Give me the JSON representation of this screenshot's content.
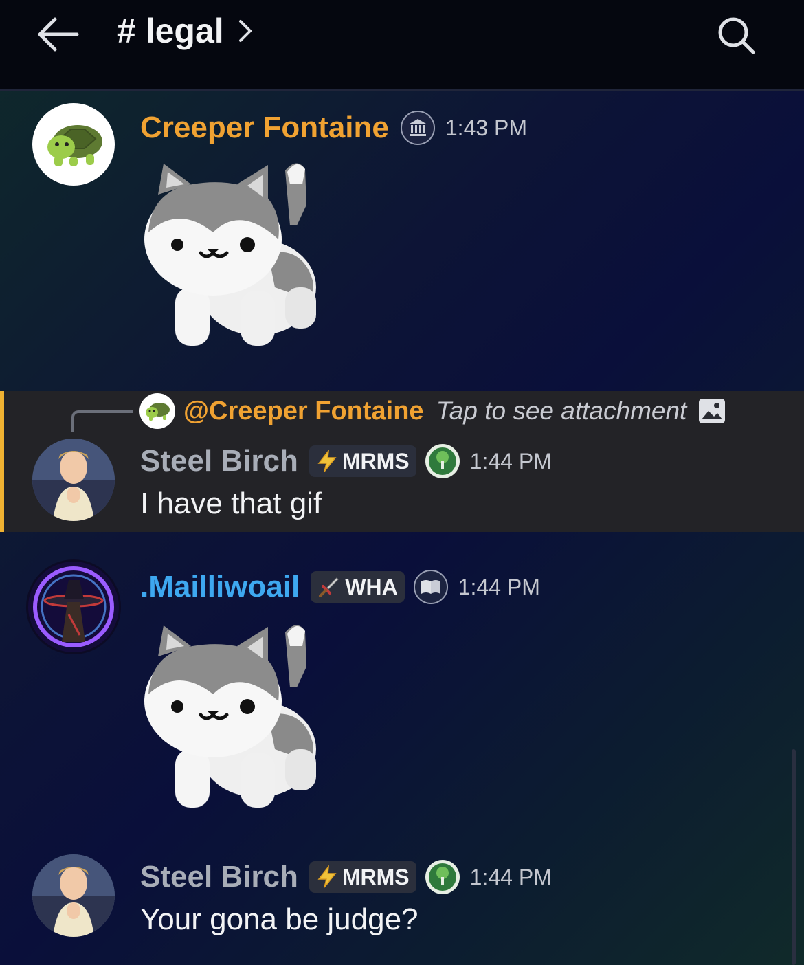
{
  "header": {
    "channel_name": "# legal"
  },
  "messages": [
    {
      "author": "Creeper Fontaine",
      "author_color": "#f0a232",
      "time": "1:43 PM",
      "attachment": "cat-gif"
    },
    {
      "reply_to": {
        "author": "@Creeper Fontaine",
        "preview": "Tap to see attachment"
      },
      "author": "Steel Birch",
      "author_color": "#a8adb7",
      "badge": "MRMS",
      "time": "1:44 PM",
      "text": "I have that gif"
    },
    {
      "author": ".Mailliwoail",
      "author_color": "#3ea8f0",
      "badge": "WHA",
      "time": "1:44 PM",
      "attachment": "cat-gif"
    },
    {
      "author": "Steel Birch",
      "author_color": "#a8adb7",
      "badge": "MRMS",
      "time": "1:44 PM",
      "text": "Your gona be judge?"
    }
  ],
  "colors": {
    "reply_highlight_border": "#f0b232",
    "header_bg": "#05070f"
  }
}
